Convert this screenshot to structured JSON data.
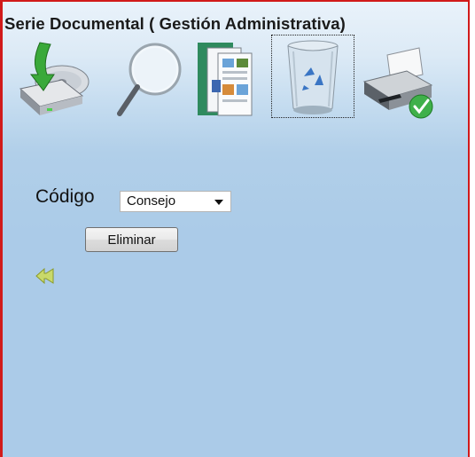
{
  "window": {
    "title": "Serie Documental ( Gestión Administrativa)"
  },
  "toolbar": {
    "items": [
      {
        "name": "import-disk",
        "icon": "disk-download-icon"
      },
      {
        "name": "search",
        "icon": "magnifier-icon"
      },
      {
        "name": "documents",
        "icon": "documents-icon"
      },
      {
        "name": "recycle-bin",
        "icon": "recycle-bin-icon",
        "selected": true
      },
      {
        "name": "print",
        "icon": "printer-check-icon"
      }
    ]
  },
  "form": {
    "codigo_label": "Código",
    "codigo_select": {
      "selected": "Consejo"
    },
    "delete_button": "Eliminar"
  },
  "colors": {
    "frame_border": "#d11a1a",
    "background": "#abcbe8",
    "back_arrow": "#c9d96a"
  }
}
